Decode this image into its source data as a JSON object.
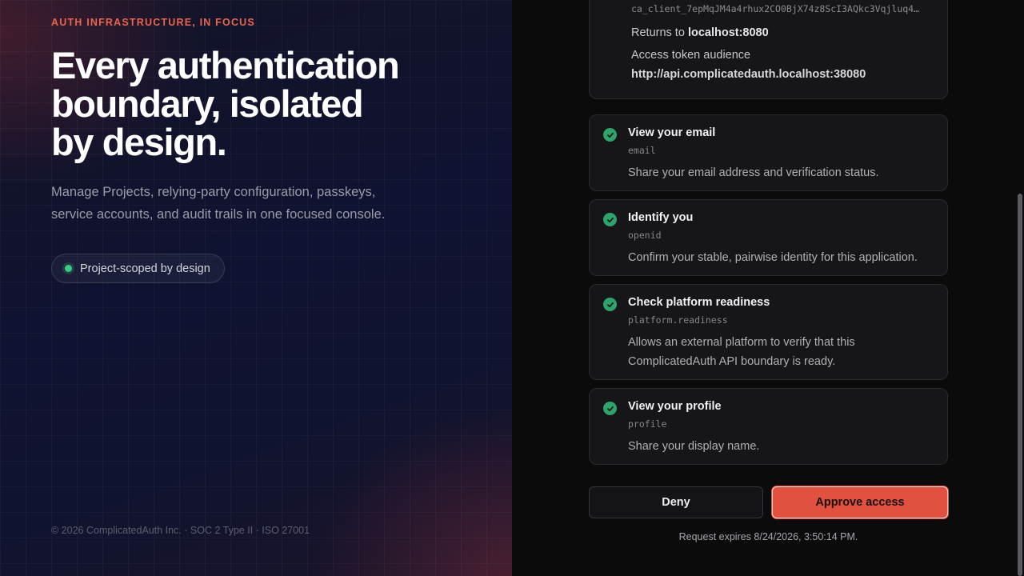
{
  "hero": {
    "eyebrow": "AUTH INFRASTRUCTURE, IN FOCUS",
    "headline_lines": [
      "Every authentication",
      "boundary, isolated",
      "by design."
    ],
    "lead": "Manage Projects, relying-party configuration, passkeys, service accounts, and audit trails in one focused console.",
    "pill_label": "Project-scoped by design",
    "footer": "© 2026 ComplicatedAuth Inc. · SOC 2 Type II · ISO 27001"
  },
  "client": {
    "client_id": "ca_client_7epMqJM4a4rhux2CO0BjX74z8ScI3AQkc3Vqjluq4…",
    "returns_prefix": "Returns to",
    "returns_host": "localhost:8080",
    "audience_label": "Access token audience",
    "audience_value": "http://api.complicatedauth.localhost:38080"
  },
  "scopes": [
    {
      "title": "View your email",
      "code": "email",
      "description": "Share your email address and verification status."
    },
    {
      "title": "Identify you",
      "code": "openid",
      "description": "Confirm your stable, pairwise identity for this application."
    },
    {
      "title": "Check platform readiness",
      "code": "platform.readiness",
      "description": "Allows an external platform to verify that this ComplicatedAuth API boundary is ready."
    },
    {
      "title": "View your profile",
      "code": "profile",
      "description": "Share your display name."
    }
  ],
  "actions": {
    "deny_label": "Deny",
    "approve_label": "Approve access"
  },
  "expires": "Request expires 8/24/2026, 3:50:14 PM.",
  "colors": {
    "accent": "#e0523f",
    "success": "#2fa36b"
  }
}
